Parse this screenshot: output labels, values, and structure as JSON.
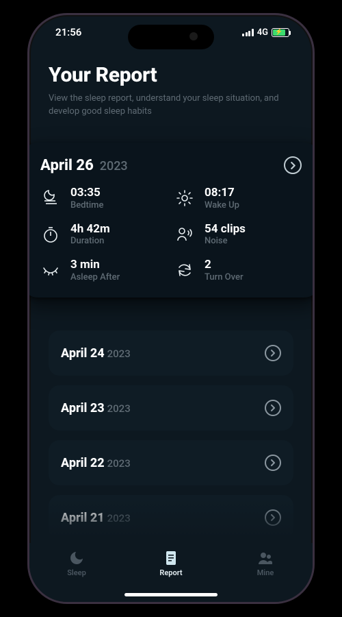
{
  "status": {
    "time": "21:56",
    "network": "4G"
  },
  "header": {
    "title": "Your Report",
    "subtitle": "View the sleep report, understand your sleep situation, and develop good sleep habits"
  },
  "featured": {
    "date": "April 26",
    "year": "2023",
    "stats": [
      {
        "icon": "moon-icon",
        "value": "03:35",
        "label": "Bedtime"
      },
      {
        "icon": "sun-icon",
        "value": "08:17",
        "label": "Wake Up"
      },
      {
        "icon": "timer-icon",
        "value": "4h 42m",
        "label": "Duration"
      },
      {
        "icon": "noise-icon",
        "value": "54 clips",
        "label": "Noise"
      },
      {
        "icon": "eye-icon",
        "value": "3 min",
        "label": "Asleep After"
      },
      {
        "icon": "turnover-icon",
        "value": "2",
        "label": "Turn Over"
      }
    ]
  },
  "reports": [
    {
      "date": "April 24",
      "year": "2023"
    },
    {
      "date": "April 23",
      "year": "2023"
    },
    {
      "date": "April 22",
      "year": "2023"
    },
    {
      "date": "April 21",
      "year": "2023"
    }
  ],
  "tabs": [
    {
      "id": "sleep",
      "label": "Sleep",
      "active": false
    },
    {
      "id": "report",
      "label": "Report",
      "active": true
    },
    {
      "id": "mine",
      "label": "Mine",
      "active": false
    }
  ]
}
